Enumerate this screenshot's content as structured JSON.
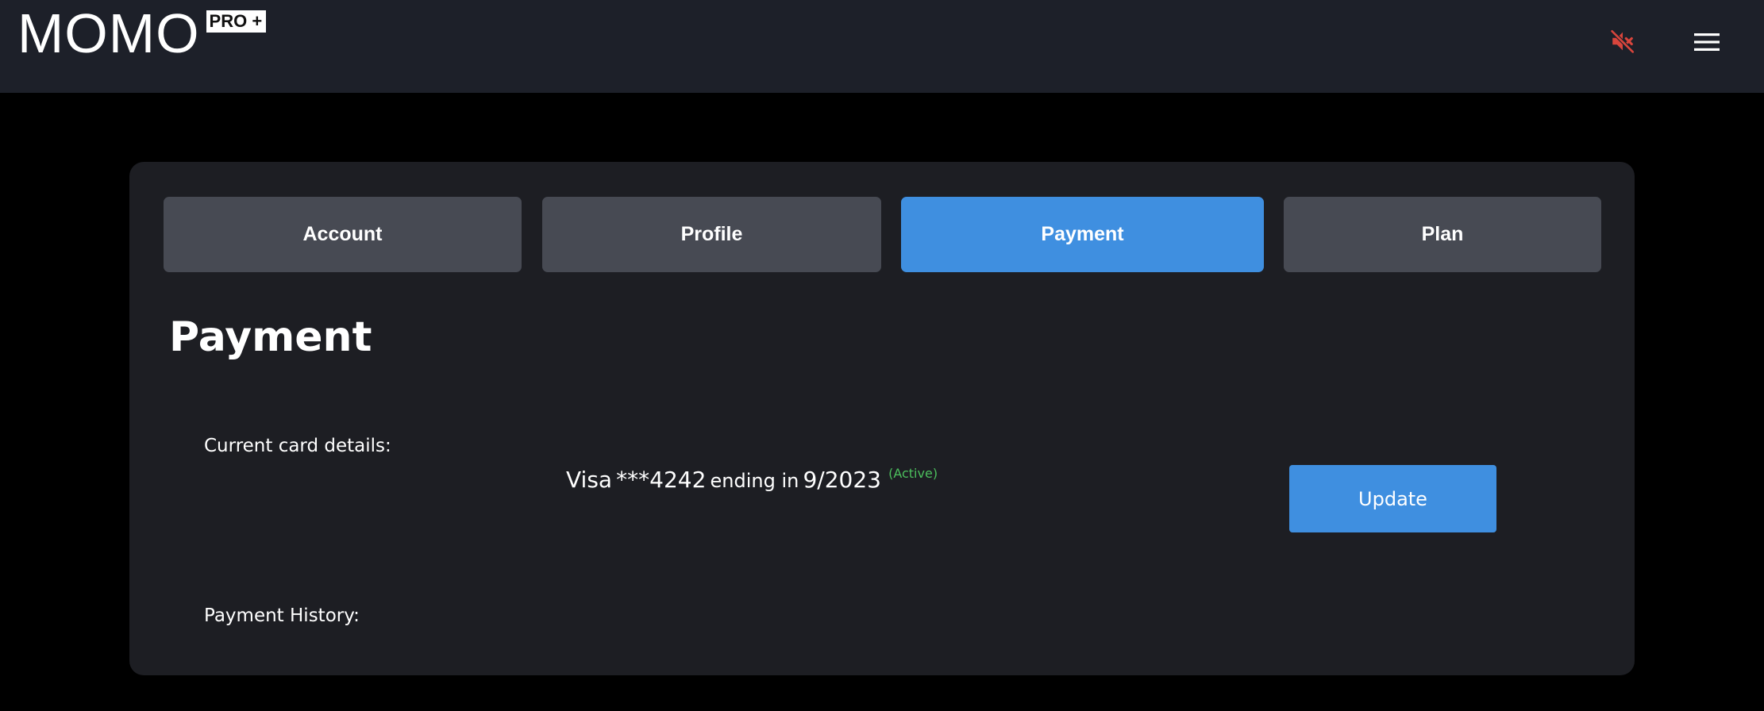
{
  "app": {
    "logo_text": "MOMO",
    "logo_badge": "PRO +"
  },
  "header": {
    "mute_icon": "speaker-muted-icon",
    "mute_color": "#d9453c",
    "menu_icon": "hamburger-menu-icon"
  },
  "tabs": [
    {
      "label": "Account",
      "active": false
    },
    {
      "label": "Profile",
      "active": false
    },
    {
      "label": "Payment",
      "active": true
    },
    {
      "label": "Plan",
      "active": false
    }
  ],
  "colors": {
    "accent": "#3f8fe0",
    "tab_inactive": "#474a53",
    "status_active": "#4cbf5d"
  },
  "payment": {
    "title": "Payment",
    "card_label": "Current card details:",
    "card_brand": "Visa",
    "card_masked": "***4242",
    "ending_text": "ending in",
    "expiry": "9/2023",
    "status": "(Active)",
    "update_label": "Update",
    "history_label": "Payment History:"
  }
}
